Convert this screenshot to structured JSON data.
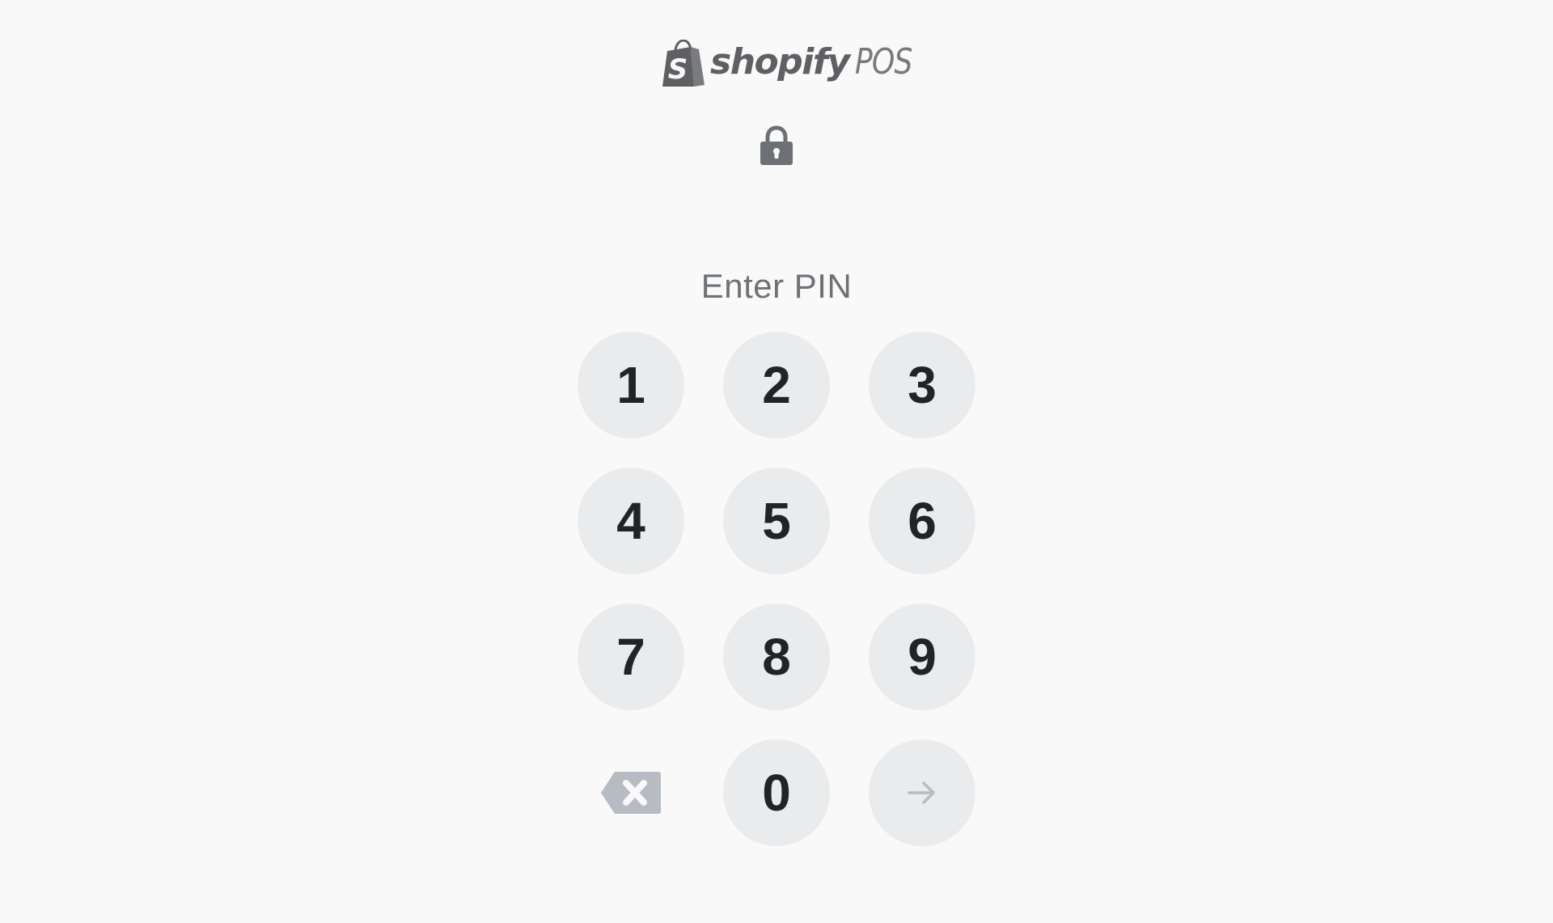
{
  "branding": {
    "wordmark": "shopify",
    "product": "POS",
    "logo_color": "#5f6064"
  },
  "lock": {
    "icon": "lock-icon"
  },
  "prompt": {
    "label": "Enter PIN"
  },
  "keypad": {
    "digits": [
      "1",
      "2",
      "3",
      "4",
      "5",
      "6",
      "7",
      "8",
      "9",
      "0"
    ],
    "delete_icon": "backspace-icon",
    "submit_icon": "arrow-right-icon",
    "key_background": "#eaebec",
    "digit_color": "#212326",
    "disabled_icon_color": "#b6bcc2"
  }
}
